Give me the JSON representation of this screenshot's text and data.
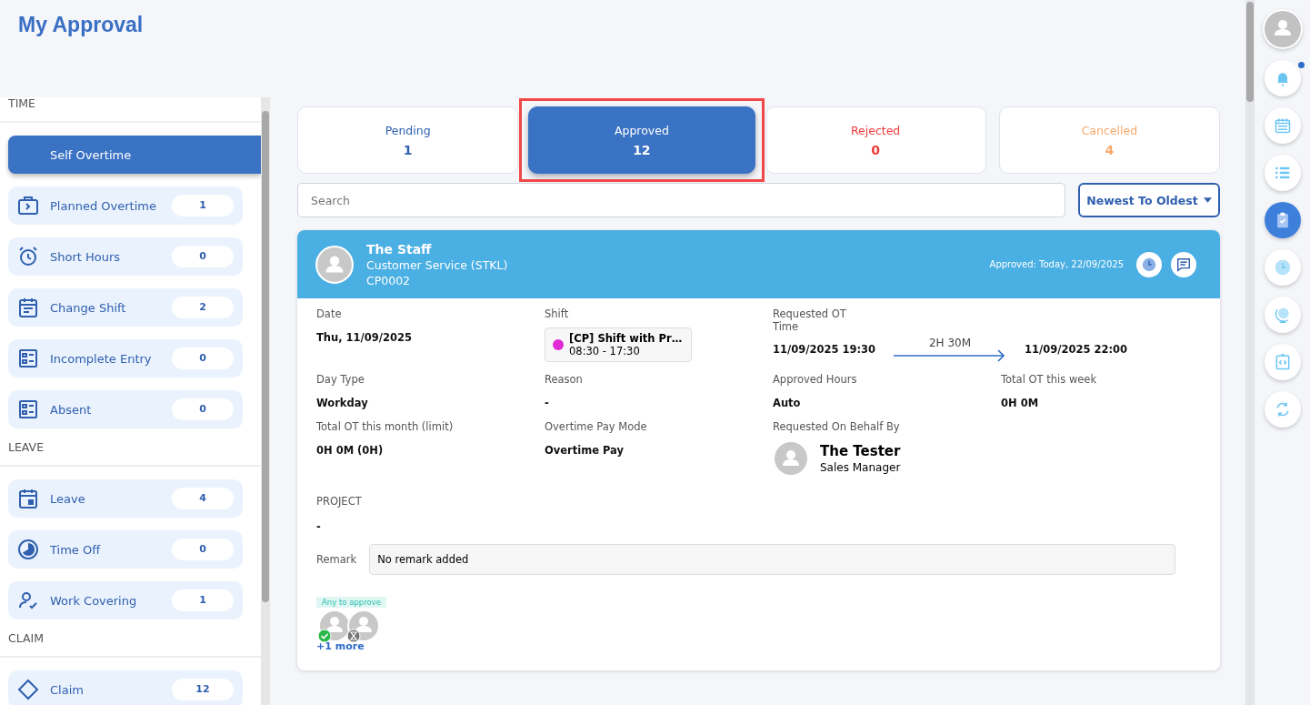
{
  "page_title": "My Approval",
  "sidebar": {
    "sections": [
      {
        "title": "TIME",
        "items": [
          {
            "label": "Self Overtime",
            "selected": true
          },
          {
            "label": "Planned Overtime",
            "count": "1",
            "selected": false
          },
          {
            "label": "Short Hours",
            "count": "0",
            "selected": false
          },
          {
            "label": "Change Shift",
            "count": "2",
            "selected": false
          },
          {
            "label": "Incomplete Entry",
            "count": "0",
            "selected": false
          },
          {
            "label": "Absent",
            "count": "0",
            "selected": false
          }
        ]
      },
      {
        "title": "LEAVE",
        "items": [
          {
            "label": "Leave",
            "count": "4",
            "selected": false
          },
          {
            "label": "Time Off",
            "count": "0",
            "selected": false
          },
          {
            "label": "Work Covering",
            "count": "1",
            "selected": false
          }
        ]
      },
      {
        "title": "CLAIM",
        "items": [
          {
            "label": "Claim",
            "count": "12",
            "selected": false
          }
        ]
      }
    ]
  },
  "status_tabs": [
    {
      "label": "Pending",
      "count": "1",
      "color": "#2f5fae",
      "selected": false,
      "highlighted": false
    },
    {
      "label": "Approved",
      "count": "12",
      "selected": true,
      "highlighted": true
    },
    {
      "label": "Rejected",
      "count": "0",
      "color": "#ef3b3b",
      "selected": false,
      "highlighted": false
    },
    {
      "label": "Cancelled",
      "count": "4",
      "color": "#f7a86a",
      "selected": false,
      "highlighted": false
    }
  ],
  "search": {
    "placeholder": "Search"
  },
  "sort_button": {
    "label": "Newest To Oldest"
  },
  "request": {
    "employee": {
      "name": "The Staff",
      "department": "Customer Service (STKL)",
      "code": "CP0002"
    },
    "approved_note": "Approved: Today, 22/09/2025",
    "date": {
      "label": "Date",
      "value": "Thu, 11/09/2025"
    },
    "shift": {
      "label": "Shift",
      "name": "[CP] Shift with Pr…",
      "hours": "08:30 - 17:30",
      "color": "#e02ad6"
    },
    "ot_time": {
      "label": "Requested OT Time",
      "start": "11/09/2025 19:30",
      "duration": "2H 30M",
      "end": "11/09/2025 22:00"
    },
    "fields": [
      {
        "label": "Day Type",
        "value": "Workday"
      },
      {
        "label": "Reason",
        "value": "-"
      },
      {
        "label": "Approved Hours",
        "value": "Auto"
      },
      {
        "label": "Total OT this week",
        "value": "0H 0M"
      },
      {
        "label": "Total OT this month (limit)",
        "value": "0H 0M (0H)"
      },
      {
        "label": "Overtime Pay Mode",
        "value": "Overtime Pay"
      }
    ],
    "behalf": {
      "label": "Requested On Behalf By",
      "name": "The Tester",
      "role": "Sales Manager"
    },
    "project": {
      "label": "PROJECT",
      "value": "-"
    },
    "remark": {
      "label": "Remark",
      "value": "No remark added"
    },
    "approvers": {
      "badge": "Any to approve",
      "list": [
        {
          "kind": "approved"
        },
        {
          "kind": "pending"
        }
      ],
      "more": "+1 more"
    }
  },
  "rail": [
    {
      "selected": false,
      "unread": false
    },
    {
      "selected": false,
      "unread": true
    },
    {
      "selected": false,
      "unread": false
    },
    {
      "selected": false,
      "unread": false
    },
    {
      "selected": true,
      "unread": false
    },
    {
      "selected": false,
      "unread": false
    },
    {
      "selected": false,
      "unread": false
    },
    {
      "selected": false,
      "unread": false
    },
    {
      "selected": false,
      "unread": false
    }
  ]
}
